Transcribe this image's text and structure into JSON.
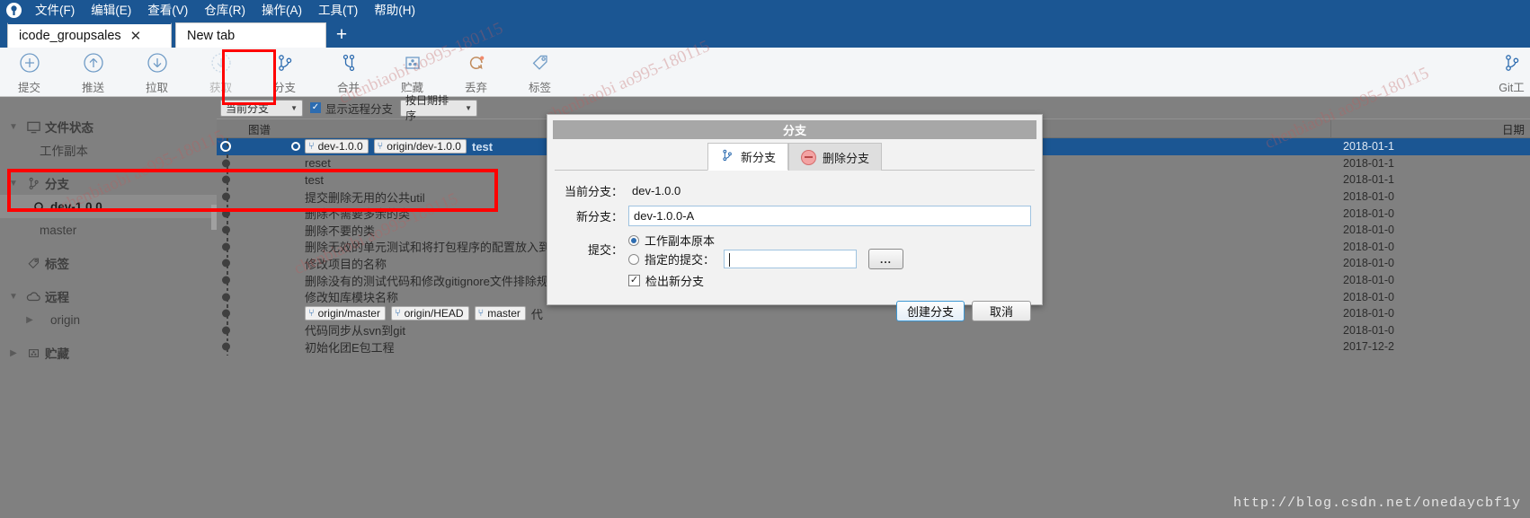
{
  "window": {
    "title": "icode_groupsales"
  },
  "menubar": {
    "logo_icon": "sourcetree-logo-icon",
    "items": [
      {
        "label": "文件(F)",
        "name": "menu-file"
      },
      {
        "label": "编辑(E)",
        "name": "menu-edit"
      },
      {
        "label": "查看(V)",
        "name": "menu-view"
      },
      {
        "label": "仓库(R)",
        "name": "menu-repository"
      },
      {
        "label": "操作(A)",
        "name": "menu-actions"
      },
      {
        "label": "工具(T)",
        "name": "menu-tools"
      },
      {
        "label": "帮助(H)",
        "name": "menu-help"
      }
    ]
  },
  "tabs": {
    "items": [
      {
        "label": "icode_groupsales",
        "active": true,
        "closable": true
      },
      {
        "label": "New tab",
        "active": false,
        "closable": false
      }
    ],
    "close_glyph": "✕",
    "new_tab_glyph": "+"
  },
  "toolbar": {
    "items": [
      {
        "label": "提交",
        "icon": "commit-plus-icon",
        "dim": false
      },
      {
        "label": "推送",
        "icon": "push-up-arrow-icon",
        "dim": false
      },
      {
        "label": "拉取",
        "icon": "pull-down-arrow-icon",
        "dim": false
      },
      {
        "label": "获取",
        "icon": "fetch-down-arrow-icon",
        "dim": true
      },
      {
        "label": "分支",
        "icon": "branch-icon",
        "dim": false
      },
      {
        "label": "合并",
        "icon": "merge-icon",
        "dim": false
      },
      {
        "label": "贮藏",
        "icon": "stash-icon",
        "dim": false
      },
      {
        "label": "丢弃",
        "icon": "discard-refresh-icon",
        "dim": false
      },
      {
        "label": "标签",
        "icon": "tag-icon",
        "dim": false
      }
    ],
    "right_item": {
      "label": "Git工",
      "icon": "branch-icon"
    }
  },
  "sidebar": {
    "groups": [
      {
        "label": "文件状态",
        "icon": "monitor-icon",
        "expanded": true,
        "children": [
          {
            "label": "工作副本",
            "selected": false
          }
        ]
      },
      {
        "label": "分支",
        "icon": "branch-icon",
        "expanded": true,
        "children": [
          {
            "label": "dev-1.0.0",
            "selected": true,
            "icon": "branch-dot-icon"
          },
          {
            "label": "master",
            "selected": false
          }
        ]
      },
      {
        "label": "标签",
        "icon": "tag-icon",
        "expanded": false,
        "children": []
      },
      {
        "label": "远程",
        "icon": "cloud-icon",
        "expanded": true,
        "children": [
          {
            "label": "origin",
            "selected": false,
            "collapsed": true
          }
        ]
      },
      {
        "label": "贮藏",
        "icon": "stash-icon",
        "expanded": false,
        "children": []
      }
    ]
  },
  "logbar": {
    "branch_filter": "当前分支",
    "show_remote_branches_label": "显示远程分支",
    "show_remote_branches_checked": true,
    "sort_order": "按日期排序"
  },
  "loglist": {
    "columns": [
      "图谱",
      "",
      "日期"
    ],
    "rows": [
      {
        "selected": true,
        "refs": [
          {
            "text": "dev-1.0.0",
            "kind": "local"
          },
          {
            "text": "origin/dev-1.0.0",
            "kind": "remote"
          }
        ],
        "message": "test",
        "date": "2018-01-1"
      },
      {
        "selected": false,
        "refs": [],
        "message": "reset",
        "date": "2018-01-1"
      },
      {
        "selected": false,
        "refs": [],
        "message": "test",
        "date": "2018-01-1"
      },
      {
        "selected": false,
        "refs": [],
        "message": "提交删除无用的公共util",
        "date": "2018-01-0"
      },
      {
        "selected": false,
        "refs": [],
        "message": "删除不需要多余的类",
        "date": "2018-01-0"
      },
      {
        "selected": false,
        "refs": [],
        "message": "删除不要的类",
        "date": "2018-01-0"
      },
      {
        "selected": false,
        "refs": [],
        "message": "删除无效的单元测试和将打包程序的配置放入到resources",
        "date": "2018-01-0"
      },
      {
        "selected": false,
        "refs": [],
        "message": "修改项目的名称",
        "date": "2018-01-0"
      },
      {
        "selected": false,
        "refs": [],
        "message": "删除没有的测试代码和修改gitignore文件排除规则",
        "date": "2018-01-0"
      },
      {
        "selected": false,
        "refs": [],
        "message": "修改知库模块名称",
        "date": "2018-01-0"
      },
      {
        "selected": false,
        "refs": [
          {
            "text": "origin/master",
            "kind": "remote"
          },
          {
            "text": "origin/HEAD",
            "kind": "remote"
          },
          {
            "text": "master",
            "kind": "local"
          }
        ],
        "message": "代",
        "date": "2018-01-0"
      },
      {
        "selected": false,
        "refs": [],
        "message": "代码同步从svn到git",
        "date": "2018-01-0"
      },
      {
        "selected": false,
        "refs": [],
        "message": "初始化团E包工程",
        "date": "2017-12-2"
      }
    ]
  },
  "dialog": {
    "title": "分支",
    "tabs": [
      {
        "label": "新分支",
        "icon": "branch-icon",
        "active": true
      },
      {
        "label": "删除分支",
        "icon": "minus-circle-icon",
        "active": false
      }
    ],
    "current_branch_label": "当前分支：",
    "current_branch_value": "dev-1.0.0",
    "new_branch_label": "新分支：",
    "new_branch_value": "dev-1.0.0-A",
    "new_branch_placeholder": "",
    "commit_label": "提交：",
    "option_working_copy": "工作副本原本",
    "option_specified_commit": "指定的提交：",
    "specified_commit_value": "",
    "specified_commit_placeholder": "",
    "browse_button": "...",
    "checkout_label": "检出新分支",
    "checkout_checked": true,
    "create_button": "创建分支",
    "cancel_button": "取消",
    "selected_option": "working_copy"
  },
  "watermarks": {
    "texts": [
      "chenbiaobi ao995-180115",
      "chenbiaobi ao995-180115",
      "chenbiaobi ao995-180115",
      "chenbiaobi ao995-180115",
      "chenbiaobi ao995-180115"
    ],
    "blog_url": "http://blog.csdn.net/onedaycbf1y"
  },
  "colors": {
    "accent": "#1b5693",
    "selection": "#1b5693",
    "highlight_box": "#ff0000",
    "chrome_gray": "#808080"
  }
}
